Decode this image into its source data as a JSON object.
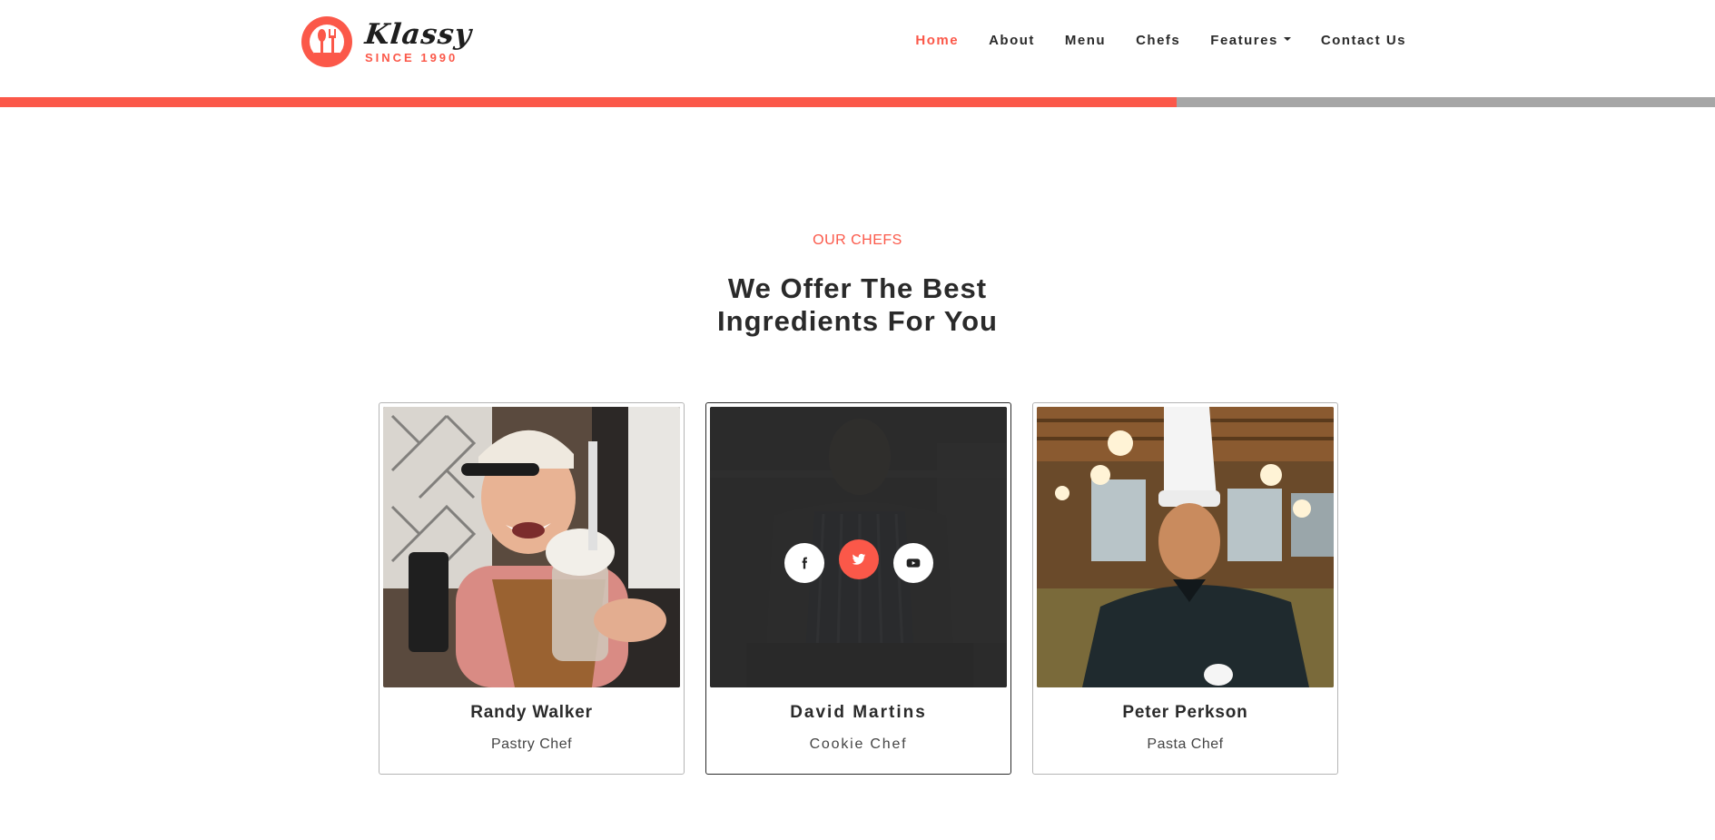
{
  "brand": {
    "name": "Klassy",
    "since": "SINCE 1990",
    "accent_color": "#fb5849"
  },
  "nav": {
    "items": [
      {
        "label": "Home",
        "active": true
      },
      {
        "label": "About"
      },
      {
        "label": "Menu"
      },
      {
        "label": "Chefs"
      },
      {
        "label": "Features",
        "dropdown": true
      },
      {
        "label": "Contact Us"
      }
    ]
  },
  "scroll_progress": {
    "fraction": 0.686,
    "fill_color": "#fb5849",
    "track_color": "#a6a6a6"
  },
  "section": {
    "eyebrow": "OUR CHEFS",
    "title_line1": "We Offer The Best",
    "title_line2": "Ingredients For You"
  },
  "chefs": [
    {
      "name": "Randy Walker",
      "role": "Pastry Chef",
      "photo": "smiling barista in cap holding milkshake"
    },
    {
      "name": "David Martins",
      "role": "Cookie Chef",
      "photo": "chef in striped apron at kitchen counter",
      "hovered": true,
      "socials": [
        "facebook-icon",
        "twitter-icon",
        "youtube-icon"
      ]
    },
    {
      "name": "Peter Perkson",
      "role": "Pasta Chef",
      "photo": "chef in white toque and black jacket in restaurant"
    }
  ]
}
